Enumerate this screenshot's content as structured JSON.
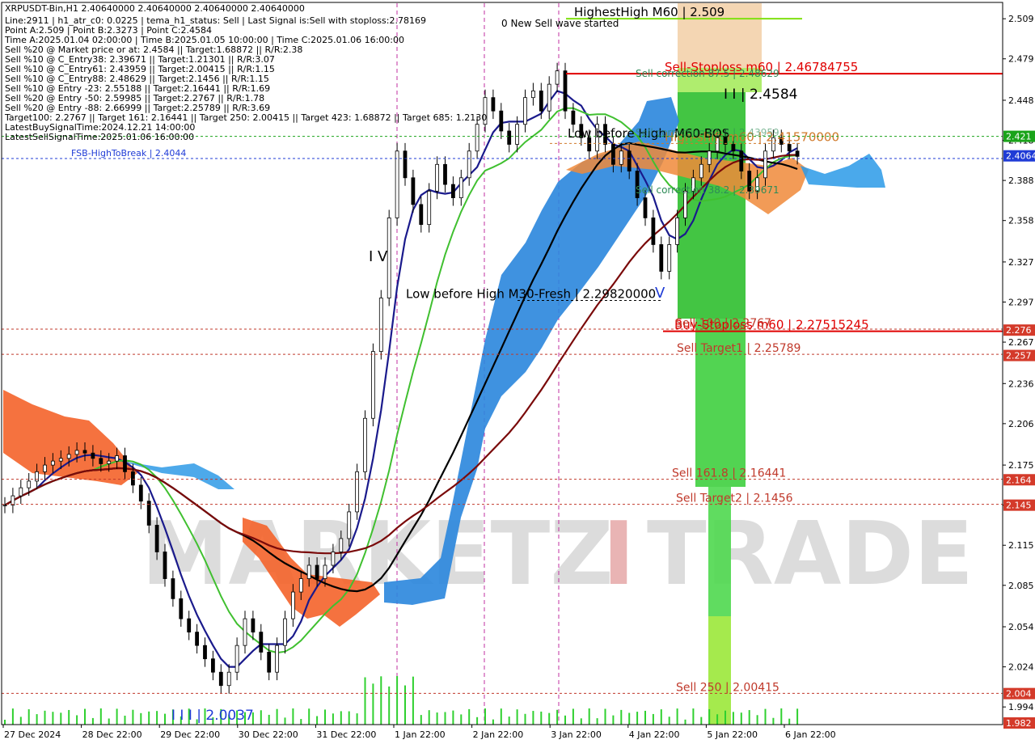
{
  "symbol_header": "XRPUSDT-Bin,H1   2.40640000  2.40640000  2.40640000  2.40640000",
  "info_lines": [
    "Line:2911  |  h1_atr_c0: 0.0225  |  tema_h1_status: Sell  |  Last Signal is:Sell with stoploss:2.78169",
    "Point A:2.509  |  Point B:2.3273  |  Point C:2.4584",
    "Time A:2025.01.04 02:00:00  |  Time B:2025.01.05 10:00:00  |  Time C:2025.01.06 16:00:00",
    "Sell %20 @ Market price or at: 2.4584  ||  Target:1.68872  ||  R/R:2.38",
    "Sell %10 @ C_Entry38: 2.39671  ||  Target:1.21301  ||  R/R:3.07",
    "Sell %10 @ C_Entry61: 2.43959  ||  Target:2.00415  ||  R/R:1.15",
    "Sell %10 @ C_Entry88: 2.48629  ||  Target:2.1456  ||  R/R:1.15",
    "Sell %10 @ Entry -23: 2.55188  ||  Target:2.16441  ||  R/R:1.69",
    "Sell %20 @ Entry -50: 2.59985  ||  Target:2.2767  ||  R/R:1.78",
    "Sell %20 @ Entry -88: 2.66999  ||  Target:2.25789  ||  R/R:3.69",
    "Target100: 2.2767  ||  Target 161: 2.16441  ||  Target 250: 2.00415  ||  Target 423: 1.68872  ||  Target 685: 1.2130",
    "LatestBuySignalTime:2024.12.21 14:00:00",
    "LatestSellSignalTime:2025.01.06 16:00:00"
  ],
  "watermark": {
    "part1": "MARKETZ",
    "part2": "I",
    "part3": "TRADE"
  },
  "chart_data": {
    "type": "candlestick",
    "symbol": "XRPUSDT-Bin",
    "timeframe": "H1",
    "ylim": [
      1.982,
      2.52
    ],
    "y_ticks": [
      "2.509",
      "2.479",
      "2.448",
      "2.418",
      "2.388",
      "2.358",
      "2.327",
      "2.297",
      "2.267",
      "2.236",
      "2.206",
      "2.175",
      "2.145",
      "2.115",
      "2.085",
      "2.054",
      "2.024",
      "1.994"
    ],
    "x_ticks": [
      "27 Dec 2024",
      "28 Dec 22:00",
      "29 Dec 22:00",
      "30 Dec 22:00",
      "31 Dec 22:00",
      "1 Jan 22:00",
      "2 Jan 22:00",
      "3 Jan 22:00",
      "4 Jan 22:00",
      "5 Jan 22:00",
      "6 Jan 22:00"
    ],
    "price_tags": [
      {
        "value": 2.421,
        "label": "2.421",
        "color": "#1aa31a"
      },
      {
        "value": 2.4064,
        "label": "2.4064",
        "color": "#1f3bd6"
      },
      {
        "value": 2.276,
        "label": "2.276",
        "color": "#d43a2a"
      },
      {
        "value": 2.257,
        "label": "2.257",
        "color": "#d43a2a"
      },
      {
        "value": 2.164,
        "label": "2.164",
        "color": "#d43a2a"
      },
      {
        "value": 2.145,
        "label": "2.145",
        "color": "#d43a2a"
      },
      {
        "value": 2.004,
        "label": "2.004",
        "color": "#d43a2a"
      },
      {
        "value": 1.982,
        "label": "1.982",
        "color": "#d43a2a"
      }
    ],
    "levels": [
      {
        "name": "HighestHigh M60",
        "value": 2.509,
        "label": "HighestHigh   M60 | 2.509",
        "color": "#7fe010"
      },
      {
        "name": "Sell-Stoploss m60",
        "value": 2.46784755,
        "label": "Sell-Stoploss m60 | 2.46784755",
        "color": "#e00000"
      },
      {
        "name": "High-shift m60",
        "value": 2.4157,
        "label": "High-shift m60 | 2.41570000",
        "color": "#d0792a"
      },
      {
        "name": "FSB-HighToBreak",
        "value": 2.4044,
        "label": "FSB-HighToBreak | 2.4044",
        "color": "#1f3bd6"
      },
      {
        "name": "Low before High M30-Fresh",
        "value": 2.2982,
        "label": "Low before High   M30-Fresh | 2.29820000",
        "color": "#000000"
      },
      {
        "name": "Buy-Stoploss m60",
        "value": 2.27515245,
        "label": "Buy-Stoploss m60 | 2.27515245",
        "color": "#e00000"
      },
      {
        "name": "Sell 100",
        "value": 2.2767,
        "label": "Sell 100 | 2.2767",
        "color": "#c0392b"
      },
      {
        "name": "Sell Target1",
        "value": 2.25789,
        "label": "Sell Target1 | 2.25789",
        "color": "#c0392b"
      },
      {
        "name": "Sell 161.8",
        "value": 2.16441,
        "label": "Sell 161.8 | 2.16441",
        "color": "#c0392b"
      },
      {
        "name": "Sell Target2",
        "value": 2.1456,
        "label": "Sell Target2 | 2.1456",
        "color": "#c0392b"
      },
      {
        "name": "Sell 250",
        "value": 2.00415,
        "label": "Sell  250 | 2.00415",
        "color": "#c0392b"
      }
    ],
    "annotations": [
      {
        "text": "0 New Sell wave started",
        "color": "#000000"
      },
      {
        "text": "Sell correction 87.5 | 2.48629",
        "color": "#2e8b57"
      },
      {
        "text": "I I | 2.4584",
        "color": "#000000"
      },
      {
        "text": "M60-BOS",
        "color": "#000000"
      },
      {
        "text": "Low before High",
        "color": "#000000"
      },
      {
        "text": "Sell correction 38.2 | 2.39671",
        "color": "#2e8b57"
      },
      {
        "text": "Sell correction 61.8 | 2.43959",
        "color": "#2e8b57"
      },
      {
        "text": "I V",
        "color": "#000000"
      },
      {
        "text": "V",
        "color": "#1f3bd6"
      },
      {
        "text": "I I I | 2.0037",
        "color": "#1f3bd6"
      }
    ],
    "series": [
      {
        "name": "close",
        "x": [
          0,
          10,
          20,
          30,
          40,
          50,
          60,
          70,
          80,
          90,
          100,
          110,
          120,
          130,
          140,
          150,
          160,
          170,
          180,
          190,
          200,
          210,
          220,
          230,
          240,
          250,
          260,
          270,
          280,
          290,
          300,
          310,
          320,
          330,
          340,
          350,
          360,
          370,
          380,
          390,
          400,
          410,
          420,
          430,
          440,
          450,
          460,
          470,
          480,
          490,
          500,
          510,
          520,
          530,
          540,
          550,
          560,
          570,
          580,
          590,
          600,
          610,
          620,
          630,
          640,
          650,
          660,
          670,
          680,
          690,
          700,
          710,
          720,
          730,
          740,
          750,
          760,
          770,
          780,
          790,
          800,
          810,
          820,
          830,
          840,
          850,
          860,
          870,
          880,
          890,
          900,
          910,
          920,
          930,
          940,
          950,
          960,
          970,
          980,
          990
        ],
        "values": [
          2.145,
          2.152,
          2.158,
          2.163,
          2.17,
          2.175,
          2.178,
          2.18,
          2.183,
          2.186,
          2.184,
          2.18,
          2.176,
          2.178,
          2.182,
          2.17,
          2.16,
          2.148,
          2.13,
          2.11,
          2.09,
          2.075,
          2.06,
          2.05,
          2.04,
          2.03,
          2.02,
          2.01,
          2.02,
          2.04,
          2.06,
          2.05,
          2.035,
          2.02,
          2.04,
          2.06,
          2.08,
          2.09,
          2.1,
          2.09,
          2.1,
          2.11,
          2.12,
          2.14,
          2.17,
          2.21,
          2.26,
          2.3,
          2.36,
          2.41,
          2.39,
          2.37,
          2.355,
          2.38,
          2.4,
          2.385,
          2.375,
          2.39,
          2.41,
          2.43,
          2.45,
          2.44,
          2.425,
          2.415,
          2.43,
          2.45,
          2.455,
          2.44,
          2.46,
          2.47,
          2.44,
          2.43,
          2.42,
          2.41,
          2.43,
          2.415,
          2.4,
          2.41,
          2.395,
          2.375,
          2.36,
          2.34,
          2.32,
          2.34,
          2.36,
          2.38,
          2.39,
          2.4,
          2.41,
          2.42,
          2.415,
          2.41,
          2.395,
          2.38,
          2.39,
          2.41,
          2.42,
          2.415,
          2.41,
          2.406
        ]
      }
    ]
  }
}
